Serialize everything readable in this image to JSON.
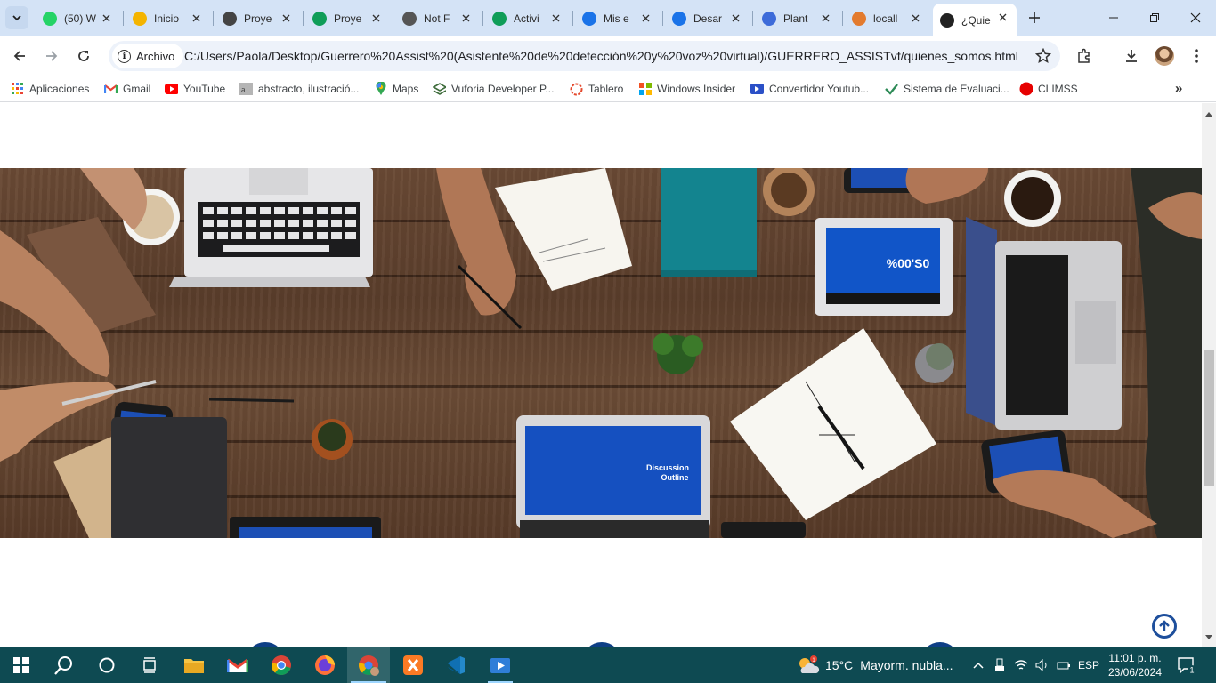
{
  "browser": {
    "tabs": [
      {
        "title": "(50) W",
        "favicon": "whatsapp-icon",
        "color": "#25d366"
      },
      {
        "title": "Inicio",
        "favicon": "classroom-icon",
        "color": "#f4b400"
      },
      {
        "title": "Proye",
        "favicon": "portfolio-icon",
        "color": "#444444"
      },
      {
        "title": "Proye",
        "favicon": "google-drive-icon",
        "color": "#0f9d58"
      },
      {
        "title": "Not F",
        "favicon": "globe-icon",
        "color": "#555555"
      },
      {
        "title": "Activi",
        "favicon": "google-drive-icon",
        "color": "#0f9d58"
      },
      {
        "title": "Mis e",
        "favicon": "info-icon",
        "color": "#1a73e8"
      },
      {
        "title": "Desar",
        "favicon": "info-icon",
        "color": "#1a73e8"
      },
      {
        "title": "Plant",
        "favicon": "canva-icon",
        "color": "#3d6bd9"
      },
      {
        "title": "locall",
        "favicon": "phpmyadmin-icon",
        "color": "#e37b2e"
      },
      {
        "title": "¿Quie",
        "favicon": "wikipedia-icon",
        "color": "#222222",
        "active": true
      }
    ],
    "address": {
      "security_chip": "Archivo",
      "url": "C:/Users/Paola/Desktop/Guerrero%20Assist%20(Asistente%20de%20detección%20y%20voz%20virtual)/GUERRERO_ASSISTvf/quienes_somos.html"
    },
    "bookmarks": [
      {
        "label": "Aplicaciones",
        "icon": "apps-grid-icon"
      },
      {
        "label": "Gmail",
        "icon": "gmail-icon"
      },
      {
        "label": "YouTube",
        "icon": "youtube-icon"
      },
      {
        "label": "abstracto, ilustració...",
        "icon": "image-icon"
      },
      {
        "label": "Maps",
        "icon": "maps-pin-icon"
      },
      {
        "label": "Vuforia Developer P...",
        "icon": "vuforia-icon"
      },
      {
        "label": "Tablero",
        "icon": "tablero-icon"
      },
      {
        "label": "Windows Insider",
        "icon": "windows-icon"
      },
      {
        "label": "Convertidor Youtub...",
        "icon": "converter-icon"
      },
      {
        "label": "Sistema de Evaluaci...",
        "icon": "evaluation-icon"
      },
      {
        "label": "CLIMSS",
        "icon": "climss-icon"
      }
    ]
  },
  "page": {
    "hero_image": "team-desk-top-view-image"
  },
  "taskbar": {
    "apps": [
      "start-icon",
      "search-icon",
      "cortana-icon",
      "task-view-icon",
      "file-explorer-icon",
      "gmail-icon",
      "chrome-icon",
      "firefox-icon",
      "chrome-profile-icon",
      "xampp-icon",
      "vscode-icon",
      "media-player-icon"
    ],
    "weather": {
      "temp": "15°C",
      "text": "Mayorm. nubla..."
    },
    "language": "ESP",
    "time": "11:01 p. m.",
    "date": "23/06/2024",
    "notifications_count": "1",
    "weather_badge": "1"
  }
}
